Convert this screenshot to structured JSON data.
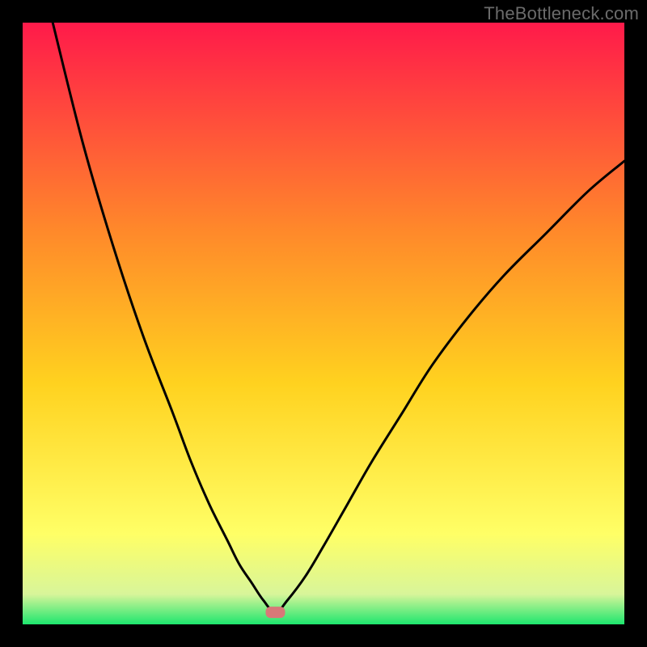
{
  "watermark": "TheBottleneck.com",
  "chart_data": {
    "type": "line",
    "title": "",
    "xlabel": "",
    "ylabel": "",
    "xlim": [
      0,
      100
    ],
    "ylim": [
      0,
      100
    ],
    "background_gradient": {
      "top": "#ff1a4a",
      "mid_upper": "#ff8a2a",
      "mid": "#ffd21f",
      "mid_lower": "#ffff66",
      "green": "#1ee66e"
    },
    "marker": {
      "x": 42,
      "y": 2,
      "color": "#d87878"
    },
    "series": [
      {
        "name": "bottleneck-curve",
        "x": [
          5,
          10,
          15,
          20,
          25,
          28,
          31,
          34,
          36,
          38,
          40,
          42,
          44,
          47,
          50,
          54,
          58,
          63,
          68,
          74,
          80,
          87,
          94,
          100
        ],
        "values": [
          100,
          80,
          63,
          48,
          35,
          27,
          20,
          14,
          10,
          7,
          4,
          2,
          4,
          8,
          13,
          20,
          27,
          35,
          43,
          51,
          58,
          65,
          72,
          77
        ]
      }
    ]
  }
}
